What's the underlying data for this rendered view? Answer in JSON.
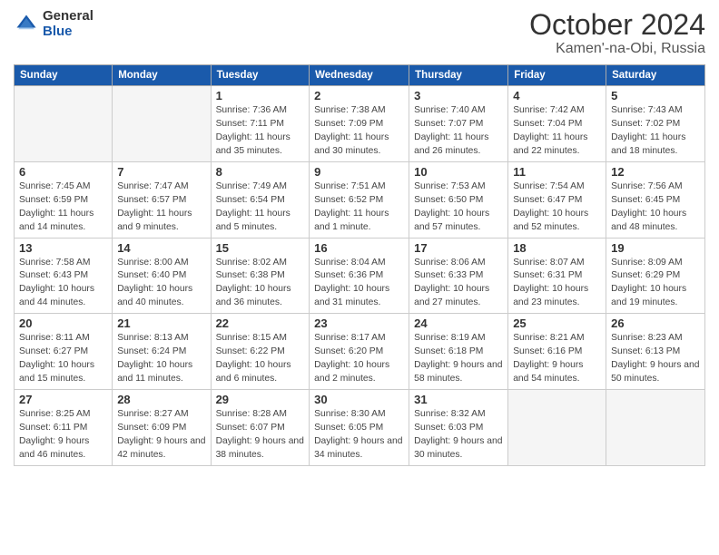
{
  "logo": {
    "general": "General",
    "blue": "Blue"
  },
  "title": {
    "month": "October 2024",
    "location": "Kamen'-na-Obi, Russia"
  },
  "weekdays": [
    "Sunday",
    "Monday",
    "Tuesday",
    "Wednesday",
    "Thursday",
    "Friday",
    "Saturday"
  ],
  "weeks": [
    [
      {
        "day": "",
        "info": ""
      },
      {
        "day": "",
        "info": ""
      },
      {
        "day": "1",
        "info": "Sunrise: 7:36 AM\nSunset: 7:11 PM\nDaylight: 11 hours and 35 minutes."
      },
      {
        "day": "2",
        "info": "Sunrise: 7:38 AM\nSunset: 7:09 PM\nDaylight: 11 hours and 30 minutes."
      },
      {
        "day": "3",
        "info": "Sunrise: 7:40 AM\nSunset: 7:07 PM\nDaylight: 11 hours and 26 minutes."
      },
      {
        "day": "4",
        "info": "Sunrise: 7:42 AM\nSunset: 7:04 PM\nDaylight: 11 hours and 22 minutes."
      },
      {
        "day": "5",
        "info": "Sunrise: 7:43 AM\nSunset: 7:02 PM\nDaylight: 11 hours and 18 minutes."
      }
    ],
    [
      {
        "day": "6",
        "info": "Sunrise: 7:45 AM\nSunset: 6:59 PM\nDaylight: 11 hours and 14 minutes."
      },
      {
        "day": "7",
        "info": "Sunrise: 7:47 AM\nSunset: 6:57 PM\nDaylight: 11 hours and 9 minutes."
      },
      {
        "day": "8",
        "info": "Sunrise: 7:49 AM\nSunset: 6:54 PM\nDaylight: 11 hours and 5 minutes."
      },
      {
        "day": "9",
        "info": "Sunrise: 7:51 AM\nSunset: 6:52 PM\nDaylight: 11 hours and 1 minute."
      },
      {
        "day": "10",
        "info": "Sunrise: 7:53 AM\nSunset: 6:50 PM\nDaylight: 10 hours and 57 minutes."
      },
      {
        "day": "11",
        "info": "Sunrise: 7:54 AM\nSunset: 6:47 PM\nDaylight: 10 hours and 52 minutes."
      },
      {
        "day": "12",
        "info": "Sunrise: 7:56 AM\nSunset: 6:45 PM\nDaylight: 10 hours and 48 minutes."
      }
    ],
    [
      {
        "day": "13",
        "info": "Sunrise: 7:58 AM\nSunset: 6:43 PM\nDaylight: 10 hours and 44 minutes."
      },
      {
        "day": "14",
        "info": "Sunrise: 8:00 AM\nSunset: 6:40 PM\nDaylight: 10 hours and 40 minutes."
      },
      {
        "day": "15",
        "info": "Sunrise: 8:02 AM\nSunset: 6:38 PM\nDaylight: 10 hours and 36 minutes."
      },
      {
        "day": "16",
        "info": "Sunrise: 8:04 AM\nSunset: 6:36 PM\nDaylight: 10 hours and 31 minutes."
      },
      {
        "day": "17",
        "info": "Sunrise: 8:06 AM\nSunset: 6:33 PM\nDaylight: 10 hours and 27 minutes."
      },
      {
        "day": "18",
        "info": "Sunrise: 8:07 AM\nSunset: 6:31 PM\nDaylight: 10 hours and 23 minutes."
      },
      {
        "day": "19",
        "info": "Sunrise: 8:09 AM\nSunset: 6:29 PM\nDaylight: 10 hours and 19 minutes."
      }
    ],
    [
      {
        "day": "20",
        "info": "Sunrise: 8:11 AM\nSunset: 6:27 PM\nDaylight: 10 hours and 15 minutes."
      },
      {
        "day": "21",
        "info": "Sunrise: 8:13 AM\nSunset: 6:24 PM\nDaylight: 10 hours and 11 minutes."
      },
      {
        "day": "22",
        "info": "Sunrise: 8:15 AM\nSunset: 6:22 PM\nDaylight: 10 hours and 6 minutes."
      },
      {
        "day": "23",
        "info": "Sunrise: 8:17 AM\nSunset: 6:20 PM\nDaylight: 10 hours and 2 minutes."
      },
      {
        "day": "24",
        "info": "Sunrise: 8:19 AM\nSunset: 6:18 PM\nDaylight: 9 hours and 58 minutes."
      },
      {
        "day": "25",
        "info": "Sunrise: 8:21 AM\nSunset: 6:16 PM\nDaylight: 9 hours and 54 minutes."
      },
      {
        "day": "26",
        "info": "Sunrise: 8:23 AM\nSunset: 6:13 PM\nDaylight: 9 hours and 50 minutes."
      }
    ],
    [
      {
        "day": "27",
        "info": "Sunrise: 8:25 AM\nSunset: 6:11 PM\nDaylight: 9 hours and 46 minutes."
      },
      {
        "day": "28",
        "info": "Sunrise: 8:27 AM\nSunset: 6:09 PM\nDaylight: 9 hours and 42 minutes."
      },
      {
        "day": "29",
        "info": "Sunrise: 8:28 AM\nSunset: 6:07 PM\nDaylight: 9 hours and 38 minutes."
      },
      {
        "day": "30",
        "info": "Sunrise: 8:30 AM\nSunset: 6:05 PM\nDaylight: 9 hours and 34 minutes."
      },
      {
        "day": "31",
        "info": "Sunrise: 8:32 AM\nSunset: 6:03 PM\nDaylight: 9 hours and 30 minutes."
      },
      {
        "day": "",
        "info": ""
      },
      {
        "day": "",
        "info": ""
      }
    ]
  ]
}
